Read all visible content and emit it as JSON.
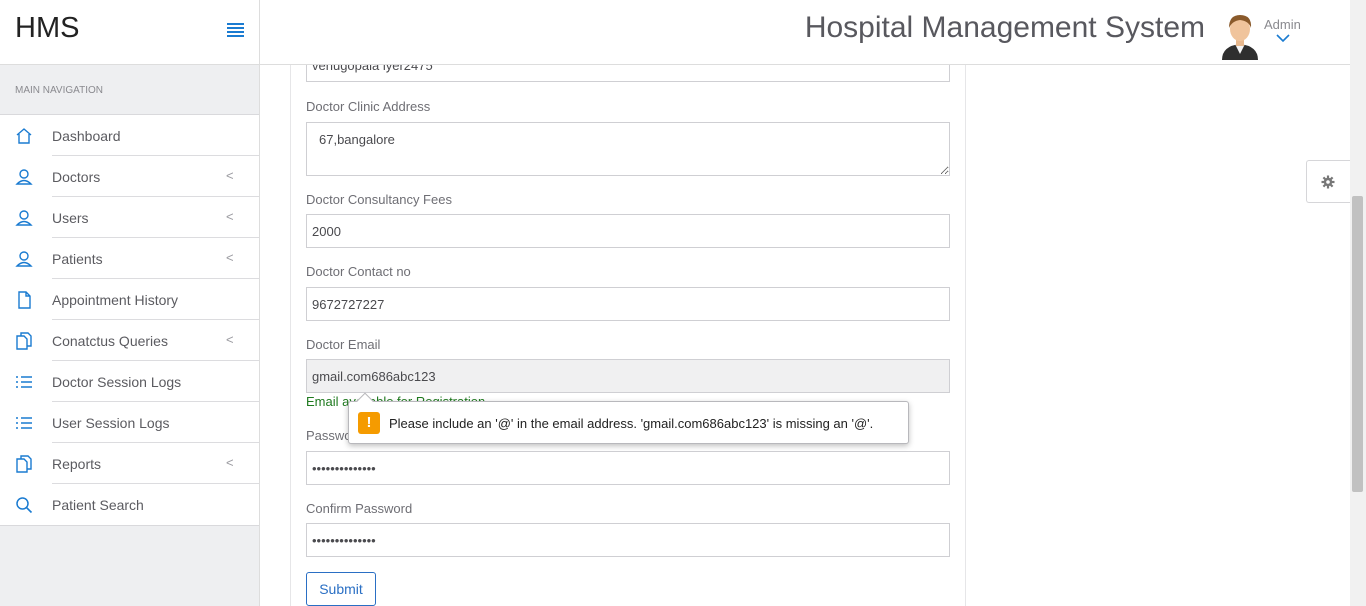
{
  "brand": {
    "title": "HMS",
    "toggle_icon": "menu-icon"
  },
  "sidebar": {
    "header": "MAIN NAVIGATION",
    "items": [
      {
        "label": "Dashboard",
        "icon": "home-icon",
        "has_submenu": false
      },
      {
        "label": "Doctors",
        "icon": "user-icon",
        "has_submenu": true
      },
      {
        "label": "Users",
        "icon": "user-icon",
        "has_submenu": true
      },
      {
        "label": "Patients",
        "icon": "user-icon",
        "has_submenu": true
      },
      {
        "label": "Appointment History",
        "icon": "file-icon",
        "has_submenu": false
      },
      {
        "label": "Conatctus Queries",
        "icon": "files-icon",
        "has_submenu": true
      },
      {
        "label": "Doctor Session Logs",
        "icon": "list-icon",
        "has_submenu": false
      },
      {
        "label": "User Session Logs",
        "icon": "list-icon",
        "has_submenu": false
      },
      {
        "label": "Reports",
        "icon": "files-icon",
        "has_submenu": true
      },
      {
        "label": "Patient Search",
        "icon": "search-icon",
        "has_submenu": false
      }
    ],
    "chevron": "<"
  },
  "header": {
    "title": "Hospital Management System",
    "user": "Admin"
  },
  "form": {
    "doctor_name_value": "venugopala iyer2475",
    "clinic_address_label": "Doctor Clinic Address",
    "clinic_address_value": "67,bangalore",
    "fees_label": "Doctor Consultancy Fees",
    "fees_value": "2000",
    "contact_label": "Doctor Contact no",
    "contact_value": "9672727227",
    "email_label": "Doctor Email",
    "email_value": "gmail.com686abc123",
    "availability": "Email available for Registration",
    "password_label": "Password",
    "password_value": "••••••••••••••",
    "confirm_password_label": "Confirm Password",
    "confirm_password_value": "••••••••••••••",
    "submit_label": "Submit"
  },
  "tooltip": {
    "icon": "!",
    "message": "Please include an '@' in the email address. 'gmail.com686abc123' is missing an '@'."
  },
  "colors": {
    "accent": "#2a6fc4",
    "icon_blue": "#1a7bd1",
    "success": "#1f7a1f",
    "warning": "#f59b00"
  }
}
